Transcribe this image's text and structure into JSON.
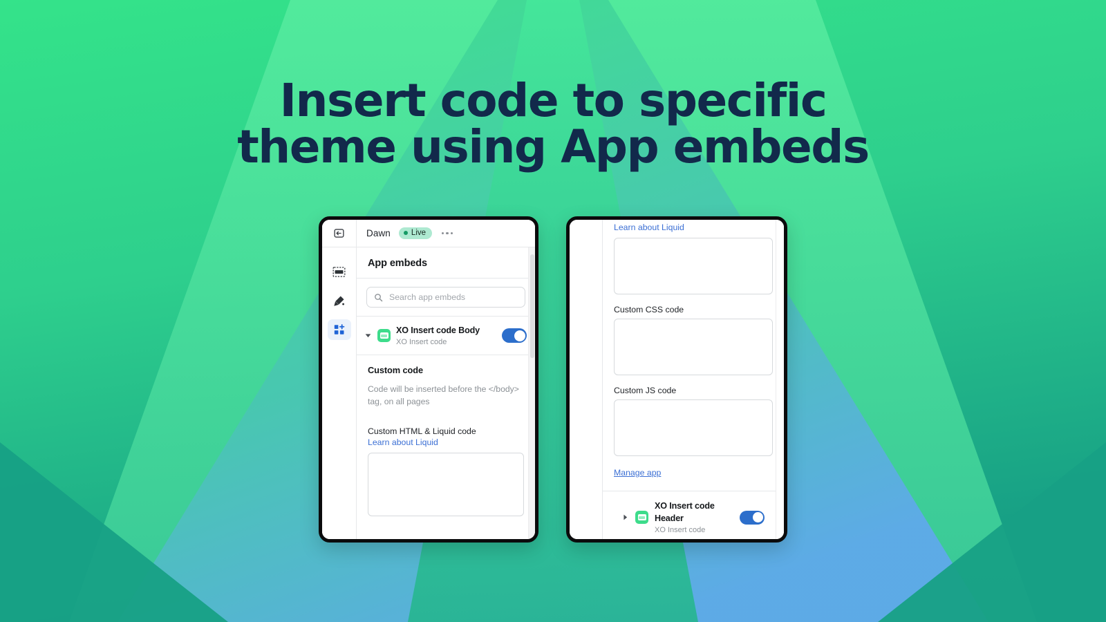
{
  "headline": {
    "line1": "Insert code to specific",
    "line2": "theme using App embeds",
    "color": "#12294b"
  },
  "colors": {
    "background_green": "#2ed987",
    "background_teal": "#17a085",
    "background_blue": "#5aaee8",
    "toggle_on": "#2c6ecb",
    "app_icon_green": "#3ddc8b",
    "link_blue": "#3b6fd4",
    "live_badge_bg": "#aee9d1",
    "live_dot": "#149a64"
  },
  "left_panel": {
    "topbar": {
      "theme_name": "Dawn",
      "status_label": "Live",
      "more_menu": "•••"
    },
    "rail": {
      "back_icon": "exit-theme-editor-icon",
      "items": [
        {
          "icon": "sections-icon",
          "name": "sections",
          "active": false
        },
        {
          "icon": "paintbrush-icon",
          "name": "theme-settings",
          "active": false
        },
        {
          "icon": "apps-grid-plus-icon",
          "name": "app-embeds",
          "active": true
        }
      ]
    },
    "section_title": "App embeds",
    "search": {
      "placeholder": "Search app embeds",
      "value": "",
      "icon": "search-icon"
    },
    "embed": {
      "caret": "expanded",
      "title": "XO Insert code Body",
      "subtitle": "XO Insert code",
      "toggle_on": true
    },
    "settings": {
      "heading": "Custom code",
      "help_text": "Code will be inserted before the </body> tag, on all pages",
      "field_label": "Custom HTML & Liquid code",
      "link_label": "Learn about Liquid",
      "textarea_value": ""
    }
  },
  "right_panel": {
    "link_top": "Learn about Liquid",
    "fields": [
      {
        "label": "Custom CSS code",
        "value": ""
      },
      {
        "label": "Custom JS code",
        "value": ""
      }
    ],
    "manage_app_link": "Manage app",
    "embed": {
      "caret": "collapsed",
      "title": "XO Insert code Header",
      "subtitle": "XO Insert code",
      "toggle_on": true
    }
  }
}
